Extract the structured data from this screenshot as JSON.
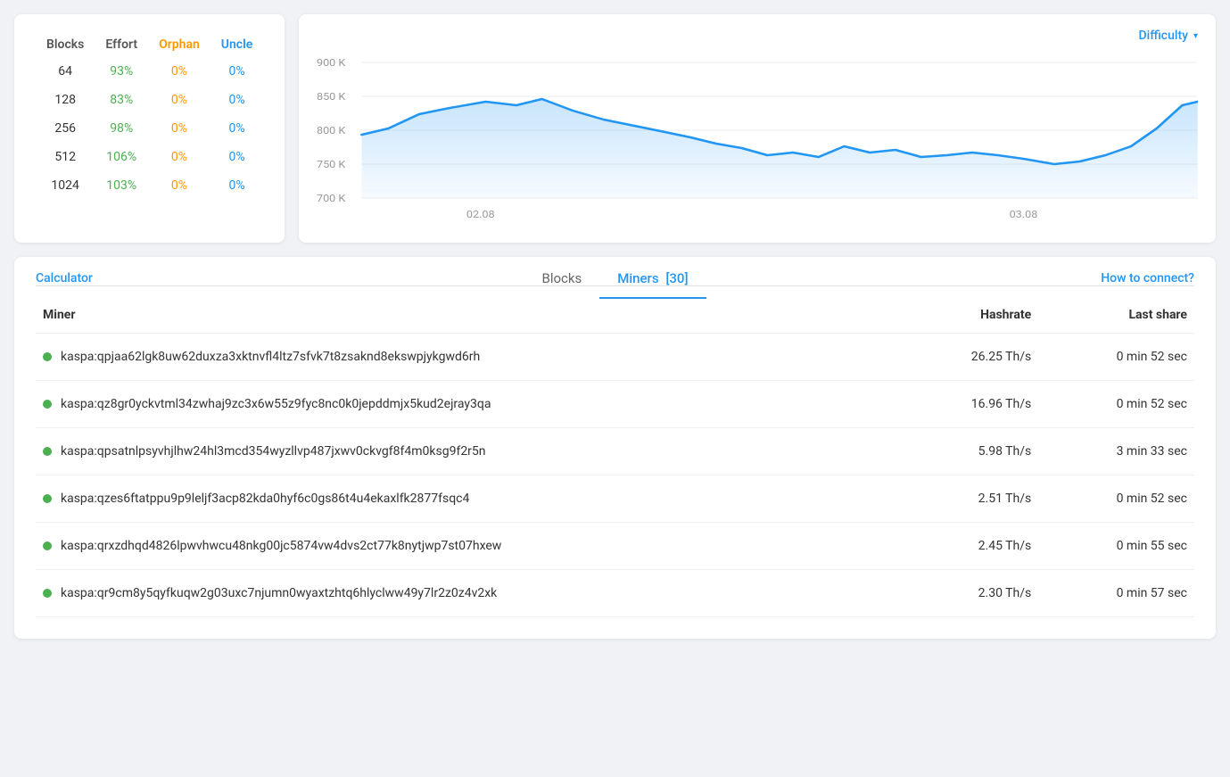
{
  "statsCard": {
    "columns": [
      "Blocks",
      "Effort",
      "Orphan",
      "Uncle"
    ],
    "rows": [
      {
        "blocks": "64",
        "effort": "93%",
        "orphan": "0%",
        "uncle": "0%"
      },
      {
        "blocks": "128",
        "effort": "83%",
        "orphan": "0%",
        "uncle": "0%"
      },
      {
        "blocks": "256",
        "effort": "98%",
        "orphan": "0%",
        "uncle": "0%"
      },
      {
        "blocks": "512",
        "effort": "106%",
        "orphan": "0%",
        "uncle": "0%"
      },
      {
        "blocks": "1024",
        "effort": "103%",
        "orphan": "0%",
        "uncle": "0%"
      }
    ]
  },
  "chart": {
    "title": "Difficulty",
    "dropdown_arrow": "▾",
    "yLabels": [
      "900 K",
      "850 K",
      "800 K",
      "750 K",
      "700 K"
    ],
    "xLabels": [
      "02.08",
      "03.08"
    ]
  },
  "tabs": {
    "calculator": "Calculator",
    "blocks": "Blocks",
    "miners": "Miners",
    "minersCount": "[30]",
    "howToConnect": "How to connect?"
  },
  "minersTable": {
    "headers": [
      "Miner",
      "Hashrate",
      "Last share"
    ],
    "rows": [
      {
        "address": "kaspa:qpjaa62lgk8uw62duxza3xktnvfl4ltz7sfvk7t8zsaknd8ekswpjykgwd6rh",
        "hashrate": "26.25 Th/s",
        "lastShare": "0 min 52 sec"
      },
      {
        "address": "kaspa:qz8gr0yckvtml34zwhaj9zc3x6w55z9fyc8nc0k0jepddmjx5kud2ejray3qa",
        "hashrate": "16.96 Th/s",
        "lastShare": "0 min 52 sec"
      },
      {
        "address": "kaspa:qpsatnlpsyvhjlhw24hl3mcd354wyzllvp487jxwv0ckvgf8f4m0ksg9f2r5n",
        "hashrate": "5.98 Th/s",
        "lastShare": "3 min 33 sec"
      },
      {
        "address": "kaspa:qzes6ftatppu9p9leljf3acp82kda0hyf6c0gs86t4u4ekaxlfk2877fsqc4",
        "hashrate": "2.51 Th/s",
        "lastShare": "0 min 52 sec"
      },
      {
        "address": "kaspa:qrxzdhqd4826lpwvhwcu48nkg00jc5874vw4dvs2ct77k8nytjwp7st07hxew",
        "hashrate": "2.45 Th/s",
        "lastShare": "0 min 55 sec"
      },
      {
        "address": "kaspa:qr9cm8y5qyfkuqw2g03uxc7njumn0wyaxtzhtq6hlyclww49y7lr2z0z4v2xk",
        "hashrate": "2.30 Th/s",
        "lastShare": "0 min 57 sec"
      }
    ]
  },
  "colors": {
    "effort": "#4caf50",
    "orphan": "#ff9800",
    "uncle": "#2196f3",
    "accent": "#2196f3",
    "chartFill": "rgba(33,150,243,0.15)",
    "chartStroke": "#2196f3",
    "green": "#4caf50"
  }
}
